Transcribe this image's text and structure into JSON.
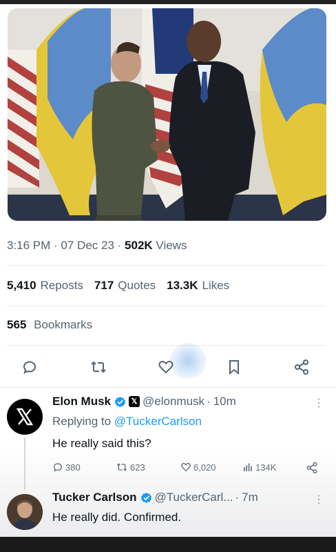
{
  "tweet": {
    "time": "3:16 PM",
    "date": "07 Dec 23",
    "views_count": "502K",
    "views_label": "Views",
    "reposts_count": "5,410",
    "reposts_label": "Reposts",
    "quotes_count": "717",
    "quotes_label": "Quotes",
    "likes_count": "13.3K",
    "likes_label": "Likes",
    "bookmarks_count": "565",
    "bookmarks_label": "Bookmarks",
    "actions": [
      "reply-icon",
      "repost-icon",
      "like-icon",
      "bookmark-icon",
      "share-icon"
    ]
  },
  "replies": [
    {
      "name": "Elon Musk",
      "handle": "@elonmusk",
      "time": "10m",
      "replying_prefix": "Replying to",
      "replying_to": "@TuckerCarlson",
      "text": "He really said this?",
      "stats": {
        "replies": "380",
        "reposts": "623",
        "likes": "6,020",
        "views": "134K"
      },
      "avatar": "x-logo"
    },
    {
      "name": "Tucker Carlson",
      "handle": "@TuckerCarl...",
      "time": "7m",
      "text": "He really did. Confirmed."
    }
  ],
  "colors": {
    "link": "#1d9bf0",
    "verified": "#1d9bf0",
    "muted": "#536471"
  }
}
